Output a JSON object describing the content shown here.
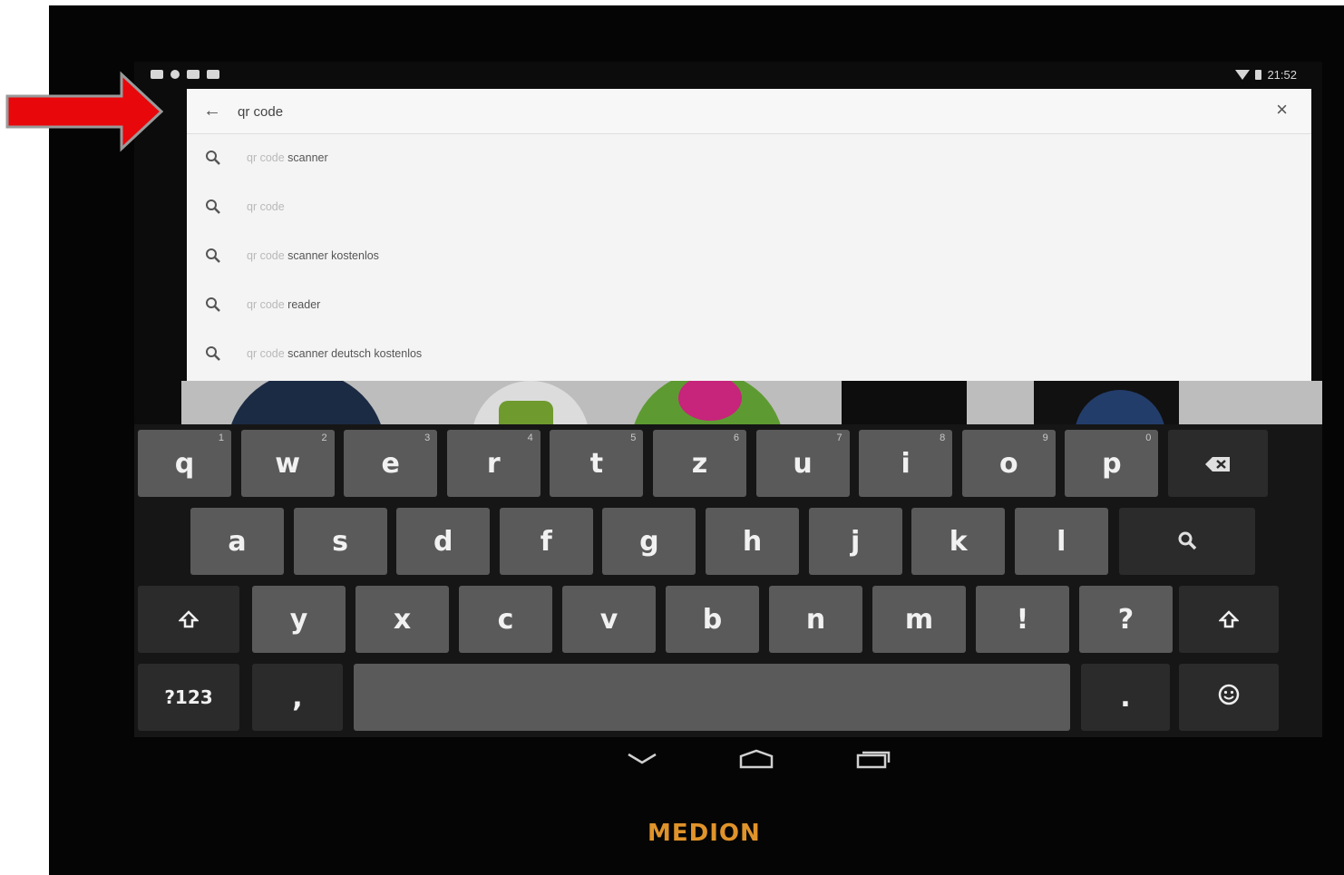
{
  "status_bar": {
    "time": "21:52"
  },
  "search": {
    "query": "qr code",
    "back_icon": "arrow-back-icon",
    "clear_icon": "close-icon"
  },
  "suggestions": [
    {
      "prefix": "qr code",
      "rest": " scanner"
    },
    {
      "prefix": "qr code",
      "rest": ""
    },
    {
      "prefix": "qr code",
      "rest": " scanner kostenlos"
    },
    {
      "prefix": "qr code",
      "rest": " reader"
    },
    {
      "prefix": "qr code",
      "rest": " scanner deutsch kostenlos"
    }
  ],
  "keyboard": {
    "row1": [
      {
        "label": "q",
        "hint": "1"
      },
      {
        "label": "w",
        "hint": "2"
      },
      {
        "label": "e",
        "hint": "3"
      },
      {
        "label": "r",
        "hint": "4"
      },
      {
        "label": "t",
        "hint": "5"
      },
      {
        "label": "z",
        "hint": "6"
      },
      {
        "label": "u",
        "hint": "7"
      },
      {
        "label": "i",
        "hint": "8"
      },
      {
        "label": "o",
        "hint": "9"
      },
      {
        "label": "p",
        "hint": "0"
      }
    ],
    "row2": [
      "a",
      "s",
      "d",
      "f",
      "g",
      "h",
      "j",
      "k",
      "l"
    ],
    "row3": [
      "y",
      "x",
      "c",
      "v",
      "b",
      "n",
      "m",
      "!",
      "?"
    ],
    "symbols_label": "?123",
    "comma_label": ",",
    "period_label": ".",
    "backspace_icon": "backspace-icon",
    "search_key_icon": "search-icon",
    "shift_icon": "shift-icon",
    "emoji_icon": "emoji-icon"
  },
  "navigation": {
    "back": "nav-back-icon",
    "home": "nav-home-icon",
    "recents": "nav-recents-icon"
  },
  "device_brand": "MEDION",
  "annotation": {
    "arrow_color": "#e8070a"
  }
}
